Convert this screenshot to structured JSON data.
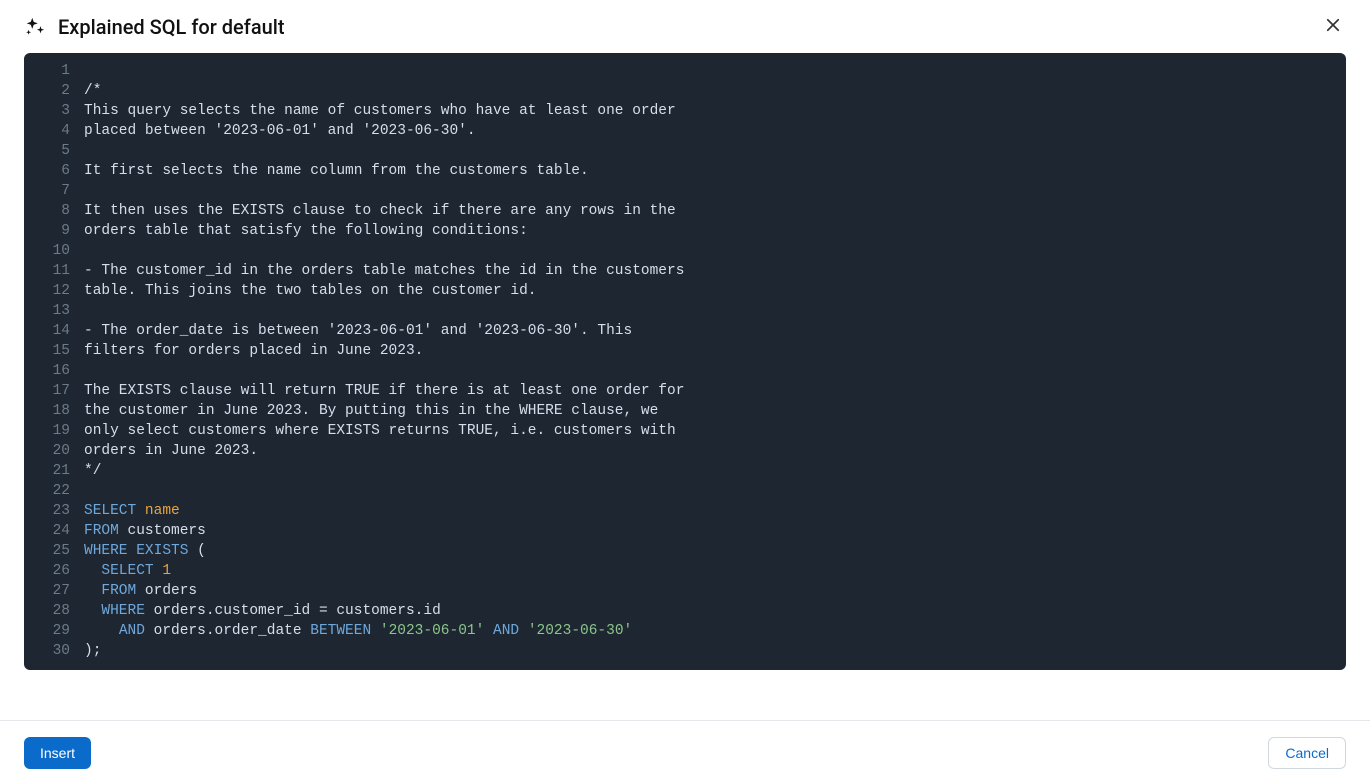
{
  "header": {
    "title": "Explained SQL for default"
  },
  "footer": {
    "insert_label": "Insert",
    "cancel_label": "Cancel"
  },
  "code": {
    "lines": [
      {
        "n": 1,
        "tokens": []
      },
      {
        "n": 2,
        "tokens": [
          {
            "t": "/*",
            "c": "tk-comment"
          }
        ]
      },
      {
        "n": 3,
        "tokens": [
          {
            "t": "This query selects the name of customers who have at least one order",
            "c": "tk-comment"
          }
        ]
      },
      {
        "n": 4,
        "tokens": [
          {
            "t": "placed between '2023-06-01' and '2023-06-30'.",
            "c": "tk-comment"
          }
        ]
      },
      {
        "n": 5,
        "tokens": []
      },
      {
        "n": 6,
        "tokens": [
          {
            "t": "It first selects the name column from the customers table.",
            "c": "tk-comment"
          }
        ]
      },
      {
        "n": 7,
        "tokens": []
      },
      {
        "n": 8,
        "tokens": [
          {
            "t": "It then uses the EXISTS clause to check if there are any rows in the",
            "c": "tk-comment"
          }
        ]
      },
      {
        "n": 9,
        "tokens": [
          {
            "t": "orders table that satisfy the following conditions:",
            "c": "tk-comment"
          }
        ]
      },
      {
        "n": 10,
        "tokens": []
      },
      {
        "n": 11,
        "tokens": [
          {
            "t": "- The customer_id in the orders table matches the id in the customers",
            "c": "tk-comment"
          }
        ]
      },
      {
        "n": 12,
        "tokens": [
          {
            "t": "table. This joins the two tables on the customer id.",
            "c": "tk-comment"
          }
        ]
      },
      {
        "n": 13,
        "tokens": []
      },
      {
        "n": 14,
        "tokens": [
          {
            "t": "- The order_date is between '2023-06-01' and '2023-06-30'. This",
            "c": "tk-comment"
          }
        ]
      },
      {
        "n": 15,
        "tokens": [
          {
            "t": "filters for orders placed in June 2023.",
            "c": "tk-comment"
          }
        ]
      },
      {
        "n": 16,
        "tokens": []
      },
      {
        "n": 17,
        "tokens": [
          {
            "t": "The EXISTS clause will return TRUE if there is at least one order for",
            "c": "tk-comment"
          }
        ]
      },
      {
        "n": 18,
        "tokens": [
          {
            "t": "the customer in June 2023. By putting this in the WHERE clause, we",
            "c": "tk-comment"
          }
        ]
      },
      {
        "n": 19,
        "tokens": [
          {
            "t": "only select customers where EXISTS returns TRUE, i.e. customers with",
            "c": "tk-comment"
          }
        ]
      },
      {
        "n": 20,
        "tokens": [
          {
            "t": "orders in June 2023.",
            "c": "tk-comment"
          }
        ]
      },
      {
        "n": 21,
        "tokens": [
          {
            "t": "*/",
            "c": "tk-comment"
          }
        ]
      },
      {
        "n": 22,
        "tokens": []
      },
      {
        "n": 23,
        "tokens": [
          {
            "t": "SELECT",
            "c": "tk-keyword"
          },
          {
            "t": " "
          },
          {
            "t": "name",
            "c": "tk-ident"
          }
        ]
      },
      {
        "n": 24,
        "tokens": [
          {
            "t": "FROM",
            "c": "tk-keyword"
          },
          {
            "t": " customers"
          }
        ]
      },
      {
        "n": 25,
        "tokens": [
          {
            "t": "WHERE",
            "c": "tk-keyword"
          },
          {
            "t": " "
          },
          {
            "t": "EXISTS",
            "c": "tk-keyword"
          },
          {
            "t": " ("
          }
        ]
      },
      {
        "n": 26,
        "tokens": [
          {
            "t": "  "
          },
          {
            "t": "SELECT",
            "c": "tk-keyword"
          },
          {
            "t": " "
          },
          {
            "t": "1",
            "c": "tk-number"
          }
        ]
      },
      {
        "n": 27,
        "tokens": [
          {
            "t": "  "
          },
          {
            "t": "FROM",
            "c": "tk-keyword"
          },
          {
            "t": " orders"
          }
        ]
      },
      {
        "n": 28,
        "tokens": [
          {
            "t": "  "
          },
          {
            "t": "WHERE",
            "c": "tk-keyword"
          },
          {
            "t": " orders.customer_id = customers.id"
          }
        ]
      },
      {
        "n": 29,
        "tokens": [
          {
            "t": "    "
          },
          {
            "t": "AND",
            "c": "tk-keyword"
          },
          {
            "t": " orders.order_date "
          },
          {
            "t": "BETWEEN",
            "c": "tk-keyword"
          },
          {
            "t": " "
          },
          {
            "t": "'2023-06-01'",
            "c": "tk-string"
          },
          {
            "t": " "
          },
          {
            "t": "AND",
            "c": "tk-keyword"
          },
          {
            "t": " "
          },
          {
            "t": "'2023-06-30'",
            "c": "tk-string"
          }
        ]
      },
      {
        "n": 30,
        "tokens": [
          {
            "t": ");"
          }
        ]
      }
    ]
  }
}
